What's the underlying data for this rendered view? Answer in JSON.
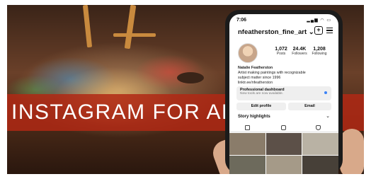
{
  "banner": {
    "title": "INSTAGRAM FOR ARTISTS"
  },
  "phone": {
    "status_time": "7:06",
    "status_icons": "▂▄▆ ◠ ▭",
    "username": "nfeatherston_fine_art",
    "username_chevron": "⌄",
    "new_post_icon": "+",
    "stats": [
      {
        "value": "1,072",
        "label": "Posts"
      },
      {
        "value": "24.4K",
        "label": "Followers"
      },
      {
        "value": "1,208",
        "label": "Following"
      }
    ],
    "bio": {
      "name": "Natalie Featherston",
      "line1": "Artist making paintings with recognizable",
      "line2": "subject matter since 1996",
      "link": "linktr.ee/nfeatherston"
    },
    "dashboard": {
      "title": "Professional dashboard",
      "subtitle": "New tools are now available."
    },
    "buttons": {
      "edit": "Edit profile",
      "email": "Email"
    },
    "highlights": {
      "label": "Story highlights",
      "chevron": "⌄"
    },
    "tab_icons": [
      "grid-icon",
      "reels-icon",
      "tagged-icon"
    ],
    "thumbnails": [
      "#8a7c6a",
      "#5c5048",
      "#b9b2a4",
      "#6d6a5c",
      "#a59a88",
      "#474038"
    ]
  }
}
